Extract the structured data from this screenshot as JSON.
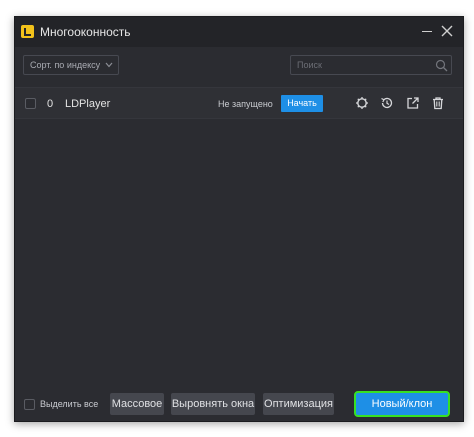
{
  "window": {
    "title": "Многооконность"
  },
  "toolbar": {
    "sort_select_value": "Сорт. по индексу",
    "search_placeholder": "Поиск"
  },
  "instances": [
    {
      "index": "0",
      "name": "LDPlayer",
      "status": "Не запущено",
      "start_label": "Начать"
    }
  ],
  "footer": {
    "select_all_label": "Выделить все",
    "bulk_label": "Массовое",
    "arrange_label": "Выровнять окна",
    "optimize_label": "Оптимизация",
    "new_clone_label": "Новый/клон"
  },
  "colors": {
    "accent": "#1e8fe6",
    "highlight": "#37e023",
    "background": "#2b2c31"
  }
}
